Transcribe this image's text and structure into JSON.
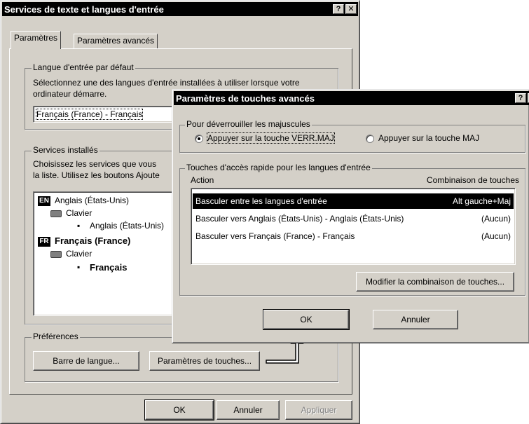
{
  "main_dialog": {
    "title": "Services de texte et langues d'entrée",
    "help_btn": "?",
    "close_btn": "✕",
    "tabs": [
      "Paramètres",
      "Paramètres avancés"
    ],
    "default_lang_group": "Langue d'entrée par défaut",
    "default_lang_desc_1": "Sélectionnez une des langues d'entrée installées à utiliser lorsque votre",
    "default_lang_desc_2": "ordinateur démarre.",
    "default_lang_value": "Français (France) - Français",
    "installed_group": "Services installés",
    "installed_desc_1": "Choisissez les services que vous",
    "installed_desc_2": "la liste. Utilisez les boutons Ajoute",
    "tree": {
      "en_badge": "EN",
      "en_label": "Anglais (États-Unis)",
      "en_keyboard": "Clavier",
      "en_layout": "Anglais (États-Unis)",
      "fr_badge": "FR",
      "fr_label": "Français (France)",
      "fr_keyboard": "Clavier",
      "fr_layout": "Français"
    },
    "prefs_group": "Préférences",
    "lang_bar_btn": "Barre de langue...",
    "key_settings_btn": "Paramètres de touches...",
    "ok": "OK",
    "cancel": "Annuler",
    "apply": "Appliquer"
  },
  "adv_dialog": {
    "title": "Paramètres de touches avancés",
    "help_btn": "?",
    "close_btn": "✕",
    "caps_group": "Pour déverrouiller les majuscules",
    "radio_caps": "Appuyer sur la touche VERR.MAJ",
    "radio_shift": "Appuyer sur la touche MAJ",
    "hotkeys_group": "Touches d'accès rapide pour les langues d'entrée",
    "col_action": "Action",
    "col_combo": "Combinaison de touches",
    "rows": [
      {
        "action": "Basculer entre les langues d'entrée",
        "combo": "Alt gauche+Maj"
      },
      {
        "action": "Basculer vers Anglais (États-Unis) - Anglais (États-Unis)",
        "combo": "(Aucun)"
      },
      {
        "action": "Basculer vers Français (France) - Français",
        "combo": "(Aucun)"
      }
    ],
    "change_btn": "Modifier la combinaison de touches...",
    "ok": "OK",
    "cancel": "Annuler"
  }
}
